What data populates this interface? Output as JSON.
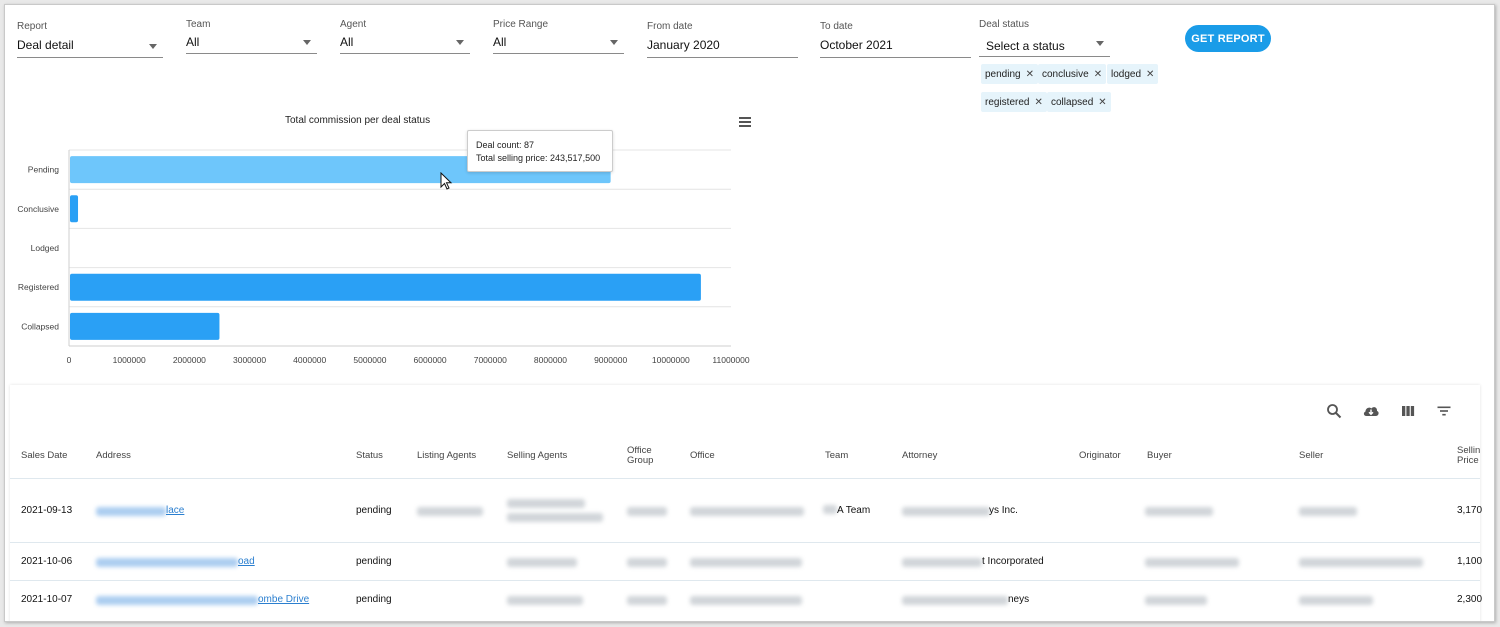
{
  "filters": {
    "report": {
      "label": "Report",
      "value": "Deal detail"
    },
    "team": {
      "label": "Team",
      "value": "All"
    },
    "agent": {
      "label": "Agent",
      "value": "All"
    },
    "price_range": {
      "label": "Price Range",
      "value": "All"
    },
    "from_date": {
      "label": "From date",
      "value": "January 2020"
    },
    "to_date": {
      "label": "To date",
      "value": "October 2021"
    },
    "deal_status": {
      "label": "Deal status",
      "placeholder": "Select a status"
    },
    "chips": [
      "pending",
      "conclusive",
      "lodged",
      "registered",
      "collapsed"
    ],
    "get_report_label": "GET REPORT"
  },
  "chart_data": {
    "type": "bar",
    "orientation": "horizontal",
    "title": "Total commission per deal status",
    "categories": [
      "Pending",
      "Conclusive",
      "Lodged",
      "Registered",
      "Collapsed"
    ],
    "values": [
      9000000,
      150000,
      0,
      10500000,
      2500000
    ],
    "xlim": [
      0,
      11000000
    ],
    "xticks": [
      "0",
      "1000000",
      "2000000",
      "3000000",
      "4000000",
      "5000000",
      "6000000",
      "7000000",
      "8000000",
      "9000000",
      "10000000",
      "11000000"
    ],
    "colors": {
      "highlight": "#6ec6fb",
      "bar": "#2aa0f5"
    },
    "grid": true
  },
  "tooltip": {
    "line1": "Deal count: 87",
    "line2": "Total selling price: 243,517,500"
  },
  "table": {
    "toolbar_icons": [
      "search-icon",
      "download-icon",
      "columns-icon",
      "filter-icon"
    ],
    "headers": {
      "sales_date": "Sales Date",
      "address": "Address",
      "status": "Status",
      "listing_agents": "Listing Agents",
      "selling_agents": "Selling Agents",
      "office_group_1": "Office",
      "office_group_2": "Group",
      "office": "Office",
      "team": "Team",
      "attorney": "Attorney",
      "originator": "Originator",
      "buyer": "Buyer",
      "seller": "Seller",
      "selling_price_1": "Sellin",
      "selling_price_2": "Price"
    },
    "rows": [
      {
        "date": "2021-09-13",
        "address": "lace",
        "status": "pending",
        "team": "A Team",
        "attorney": "ys Inc.",
        "price": "3,170"
      },
      {
        "date": "2021-10-06",
        "address": "oad",
        "status": "pending",
        "team": "",
        "attorney": "t Incorporated",
        "price": "1,100"
      },
      {
        "date": "2021-10-07",
        "address": "ombe Drive",
        "status": "pending",
        "team": "",
        "attorney": "neys",
        "price": "2,300"
      }
    ]
  }
}
